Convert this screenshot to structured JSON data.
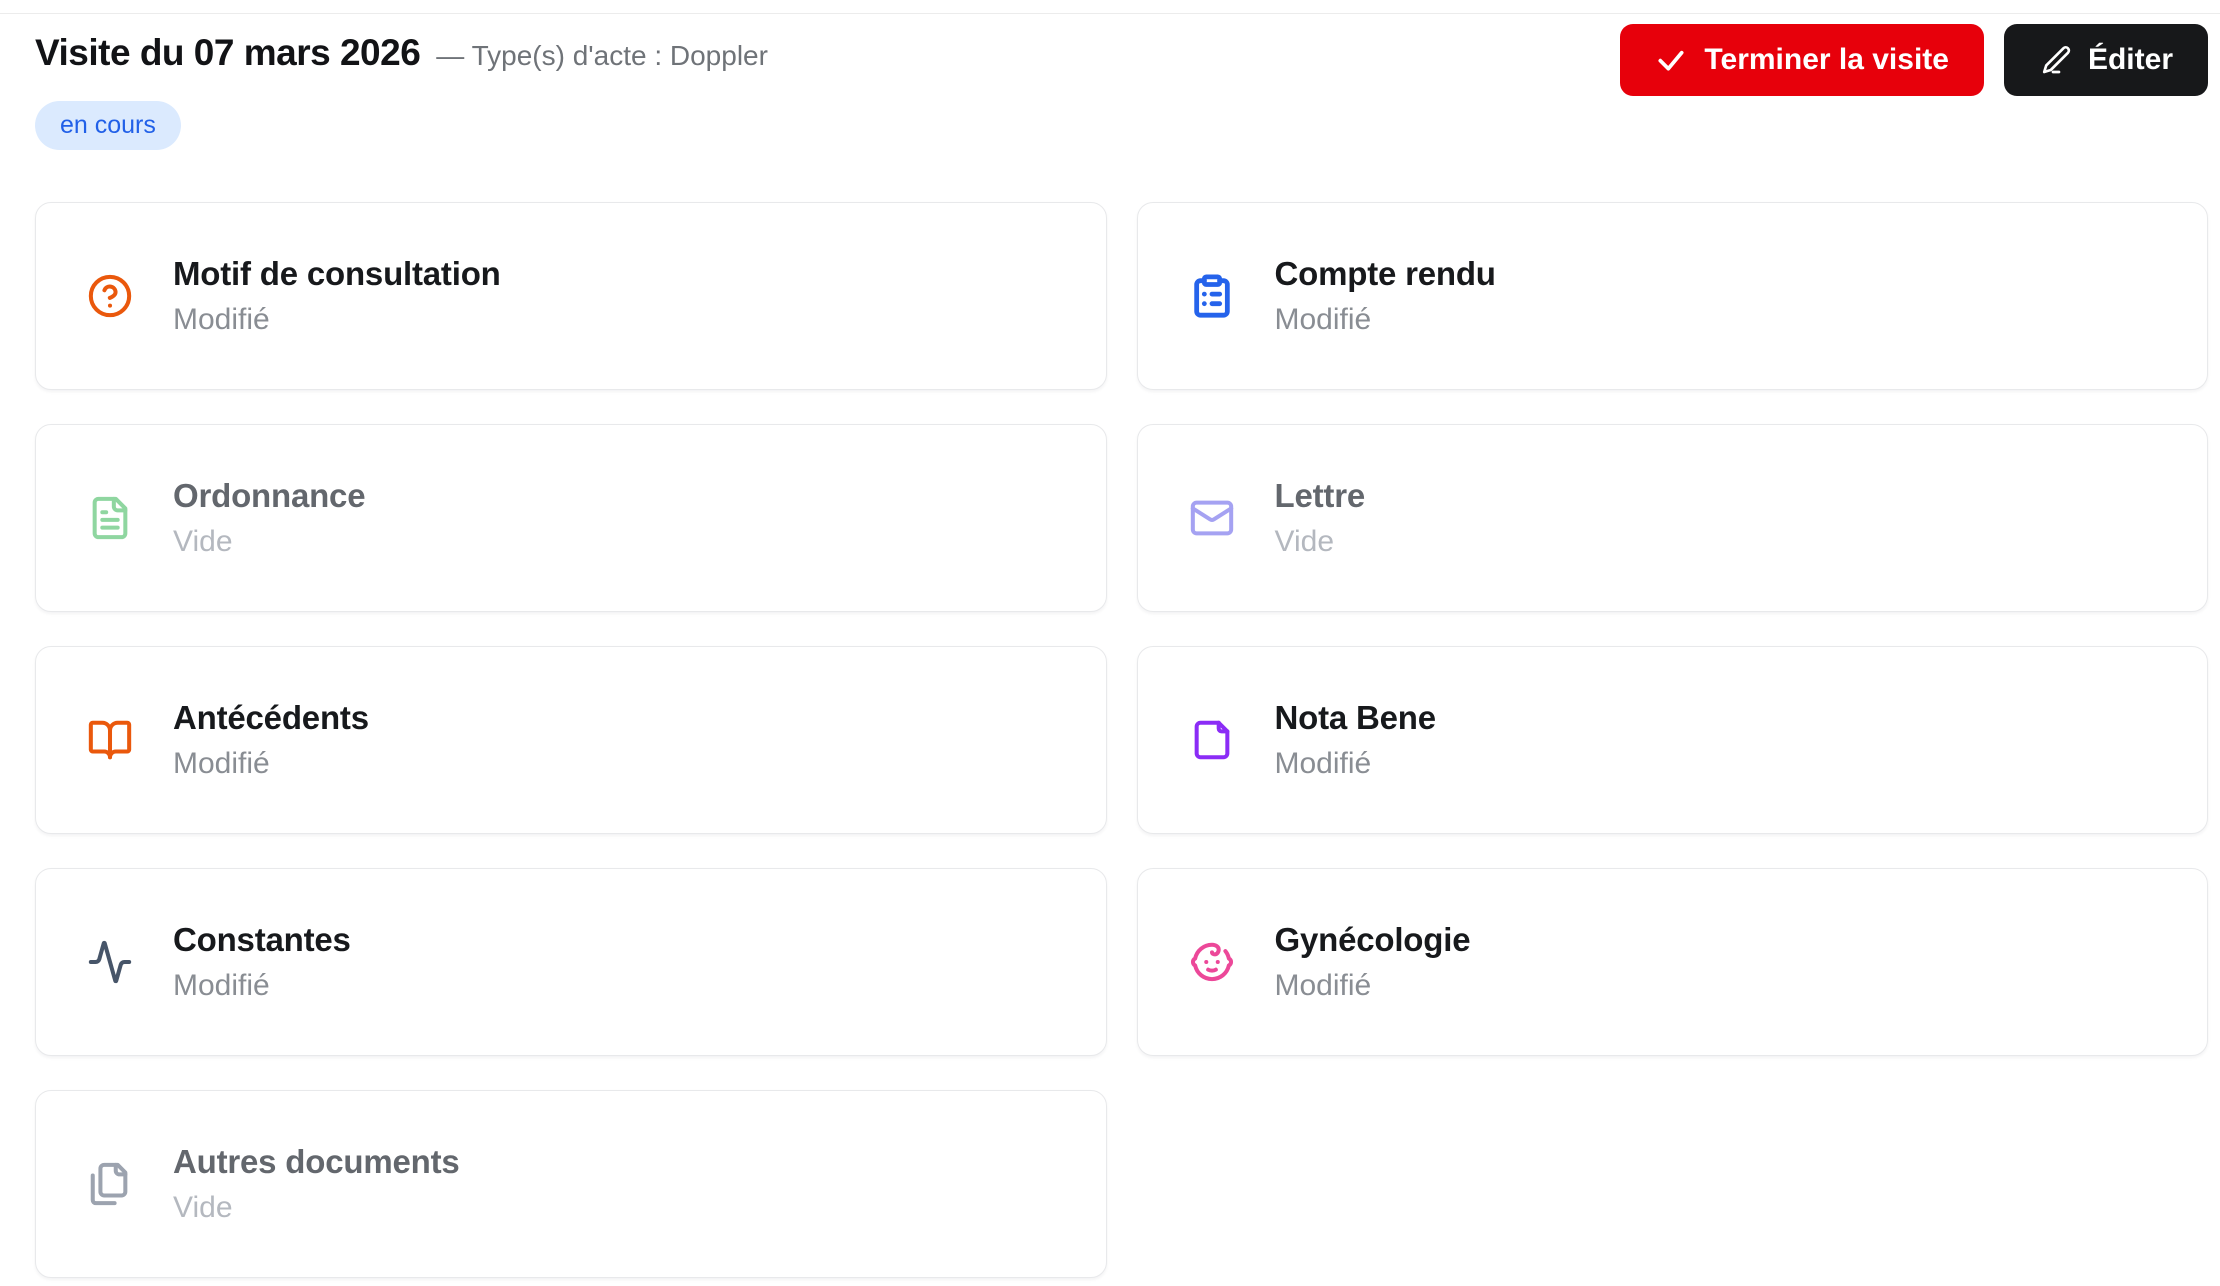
{
  "header": {
    "title": "Visite du 07 mars 2026",
    "subtitle": "— Type(s) d'acte : Doppler",
    "status_badge": "en cours",
    "finish_button_label": "Terminer la visite",
    "edit_button_label": "Éditer"
  },
  "colors": {
    "finish_button_bg": "#e7000b",
    "edit_button_bg": "#17181a",
    "badge_bg": "#dbeafe",
    "badge_text": "#2160e8",
    "card_border": "#e8e9eb"
  },
  "cards": [
    {
      "id": "motif-de-consultation",
      "title": "Motif de consultation",
      "status": "Modifié",
      "icon": "circle-help-icon",
      "icon_color": "#ea580c",
      "muted": false
    },
    {
      "id": "compte-rendu",
      "title": "Compte rendu",
      "status": "Modifié",
      "icon": "clipboard-list-icon",
      "icon_color": "#2563eb",
      "muted": false
    },
    {
      "id": "ordonnance",
      "title": "Ordonnance",
      "status": "Vide",
      "icon": "file-text-icon",
      "icon_color": "#8fd6a0",
      "muted": true
    },
    {
      "id": "lettre",
      "title": "Lettre",
      "status": "Vide",
      "icon": "mail-icon",
      "icon_color": "#a5a2f2",
      "muted": true
    },
    {
      "id": "antecedents",
      "title": "Antécédents",
      "status": "Modifié",
      "icon": "book-open-icon",
      "icon_color": "#ea580c",
      "muted": false
    },
    {
      "id": "nota-bene",
      "title": "Nota Bene",
      "status": "Modifié",
      "icon": "note-icon",
      "icon_color": "#8b2cf6",
      "muted": false
    },
    {
      "id": "constantes",
      "title": "Constantes",
      "status": "Modifié",
      "icon": "activity-icon",
      "icon_color": "#475569",
      "muted": false
    },
    {
      "id": "gynecologie",
      "title": "Gynécologie",
      "status": "Modifié",
      "icon": "baby-icon",
      "icon_color": "#ec4899",
      "muted": false
    },
    {
      "id": "autres-documents",
      "title": "Autres documents",
      "status": "Vide",
      "icon": "files-icon",
      "icon_color": "#9ca3af",
      "muted": true
    }
  ]
}
